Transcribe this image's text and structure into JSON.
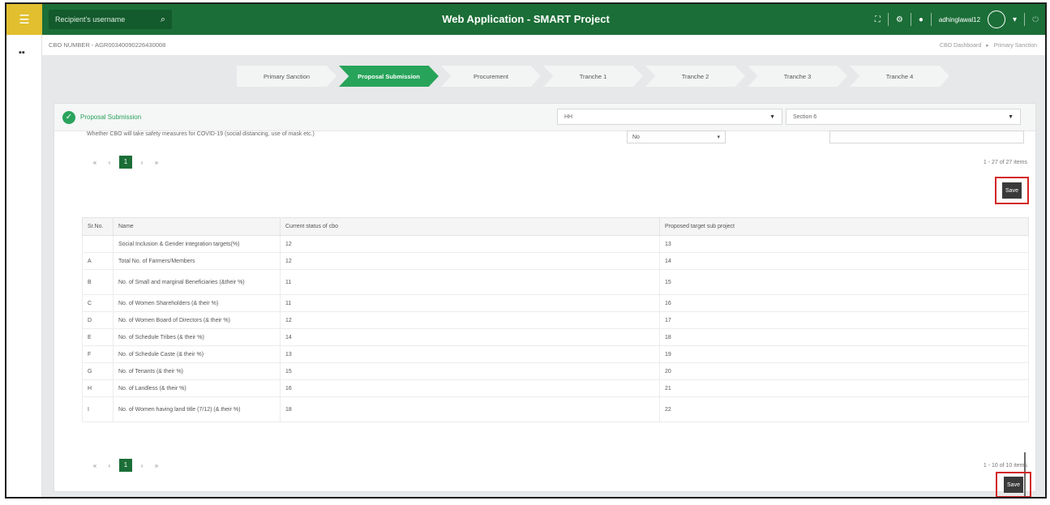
{
  "topbar": {
    "search_placeholder": "Recipient's username",
    "title": "Web Application - SMART Project",
    "user": "adhinglawal12"
  },
  "subheader": {
    "cbo_number": "CBO NUMBER - AGR00340090226430008",
    "breadcrumb": [
      "CBO Dashboard",
      "Primary Sanction"
    ]
  },
  "stepper": [
    "Primary Sanction",
    "Proposal Submission",
    "Procurement",
    "Tranche 1",
    "Tranche 2",
    "Tranche 3",
    "Tranche 4"
  ],
  "panel": {
    "title": "Proposal Submission",
    "select1": "HH",
    "select2": "Section 6",
    "previous_row_text": "Whether CBO will take safety measures for COVID-19 (social distancing, use of mask etc.)",
    "previous_row_select": "No",
    "pager_top": {
      "current": "1",
      "info": "1 - 27 of 27 items"
    },
    "pager_bottom": {
      "current": "1",
      "info": "1 - 10 of 10 items"
    },
    "save_label": "Save"
  },
  "table": {
    "headers": [
      "Sr.No.",
      "Name",
      "Current status of cbo",
      "Proposed target sub project"
    ],
    "rows": [
      [
        "",
        "Social Inclusion & Gender integration targets(%)",
        "12",
        "13"
      ],
      [
        "A",
        "Total No. of Farmers/Members",
        "12",
        "14"
      ],
      [
        "B",
        "No. of Small and marginal Beneficiaries (&their %)",
        "11",
        "15"
      ],
      [
        "C",
        "No. of Women Shareholders (& their %)",
        "11",
        "16"
      ],
      [
        "D",
        "No. of Women Board of Directors (& their %)",
        "12",
        "17"
      ],
      [
        "E",
        "No. of Schedule Tribes (& their %)",
        "14",
        "18"
      ],
      [
        "F",
        "No. of Schedule Caste (& their %)",
        "13",
        "19"
      ],
      [
        "G",
        "No. of Tenants (& their %)",
        "15",
        "20"
      ],
      [
        "H",
        "No. of Landless (& their %)",
        "16",
        "21"
      ],
      [
        "I",
        "No. of Women having land title (7/12) (& their %)",
        "18",
        "22"
      ]
    ]
  },
  "colors": {
    "brand_green": "#1b6e37",
    "accent_green": "#27a45a",
    "hamburger_yellow": "#e1bf2e",
    "highlight_red": "#d32626"
  }
}
